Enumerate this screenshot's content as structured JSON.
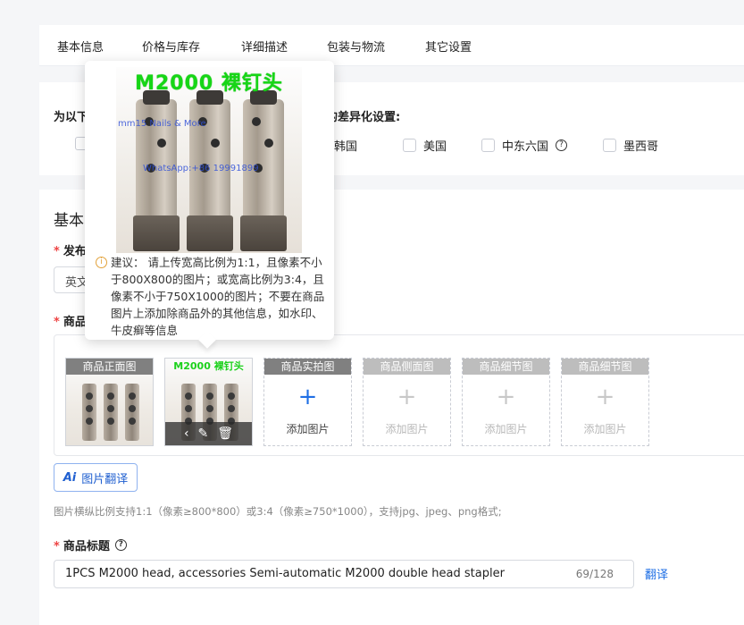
{
  "tabs": [
    "基本信息",
    "价格与库存",
    "详细描述",
    "包装与物流",
    "其它设置"
  ],
  "region": {
    "title_left": "为以下",
    "title_right": "的差异化设置:",
    "options": [
      "韩国",
      "美国",
      "中东六国",
      "墨西哥"
    ]
  },
  "basic": {
    "section_title": "基本",
    "publish_label": "发布",
    "language_value": "英文",
    "images_label": "商品",
    "slots": [
      {
        "label": "商品正面图",
        "add": ""
      },
      {
        "label": "",
        "add": ""
      },
      {
        "label": "商品实拍图",
        "add": "添加图片"
      },
      {
        "label": "商品侧面图",
        "add": "添加图片"
      },
      {
        "label": "商品细节图",
        "add": "添加图片"
      },
      {
        "label": "商品细节图",
        "add": "添加图片"
      }
    ],
    "thumb_title": "M2000 裸钉头",
    "ai_button": "图片翻译",
    "hint": "图片横纵比例支持1:1（像素≥800*800）或3:4（像素≥750*1000），支持jpg、jpeg、png格式;",
    "title_label": "商品标题",
    "title_value": "1PCS M2000 head, accessories Semi-automatic M2000 double head stapler",
    "title_count": "69/128",
    "translate": "翻译"
  },
  "popover": {
    "image_title": "M2000 裸钉头",
    "watermark1": "mm15 Nails & More",
    "watermark2": "WhatsApp:+86 19991899",
    "tip": "建议： 请上传宽高比例为1:1，且像素不小于800X800的图片；或宽高比例为3:4，且像素不小于750X1000的图片；不要在商品图片上添加除商品外的其他信息，如水印、牛皮癣等信息"
  },
  "icons": {
    "help": "question-circle-icon",
    "warn": "info-circle-icon",
    "plus": "plus-icon",
    "edit": "edit-icon",
    "delete": "trash-icon",
    "prev": "chevron-left-icon"
  },
  "colors": {
    "accent": "#1f6fe5",
    "required": "#e44444",
    "slot_label": "#808080",
    "watermark_green": "#16d616"
  }
}
